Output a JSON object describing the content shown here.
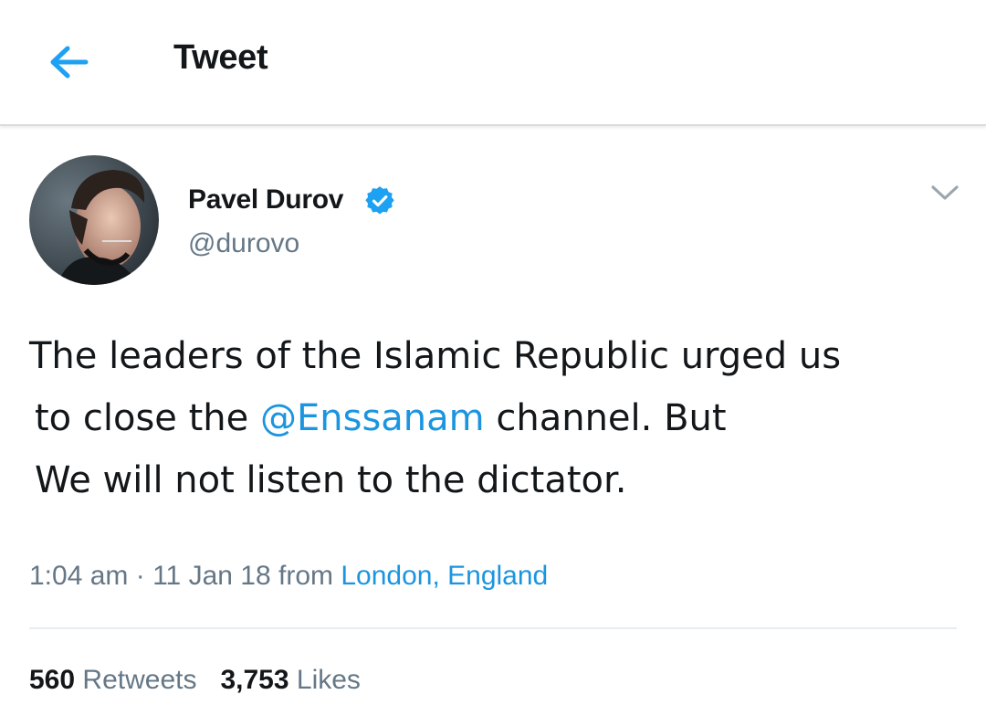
{
  "header": {
    "title": "Tweet",
    "back_icon": "arrow-left-icon"
  },
  "tweet": {
    "author": {
      "name": "Pavel Durov",
      "handle": "@durovo",
      "verified": true
    },
    "text": {
      "line1": "The leaders of the Islamic Republic urged us",
      "line2_before": "to close the ",
      "mention": "@Enssanam",
      "line2_after": " channel. But",
      "line3": "We will not listen to the dictator."
    },
    "meta": {
      "time": "1:04 am",
      "separator": "·",
      "date": "11 Jan 18",
      "from_label": "from",
      "location": "London, England"
    },
    "stats": {
      "retweets_count": "560",
      "retweets_label": "Retweets",
      "likes_count": "3,753",
      "likes_label": "Likes"
    }
  },
  "colors": {
    "accent": "#1b95e0",
    "text_primary": "#14171a",
    "text_secondary": "#657786",
    "divider": "#e6ecf0"
  }
}
